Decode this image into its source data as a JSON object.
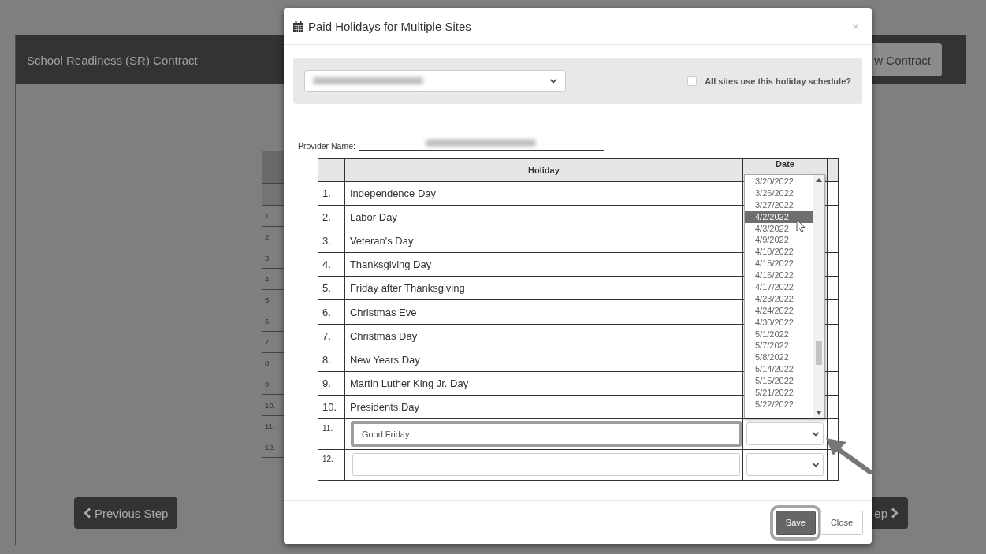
{
  "page": {
    "title": "School Readiness (SR) Contract",
    "header_button": "w Contract",
    "background_rows": [
      "1.",
      "2.",
      "3.",
      "4.",
      "5.",
      "6.",
      "7.",
      "8.",
      "9.",
      "10.",
      "11.",
      "12."
    ],
    "previous_button": "Previous Step",
    "next_button": "ep"
  },
  "modal": {
    "title": "Paid Holidays for Multiple Sites",
    "close": "×",
    "all_sites": {
      "label": "All sites use this holiday schedule?",
      "checked": false
    },
    "provider_label": "Provider Name:",
    "columns": [
      "Holiday",
      "Date"
    ],
    "rows": [
      {
        "number": "1.",
        "kind": "text",
        "holiday": "Independence Day"
      },
      {
        "number": "2.",
        "kind": "text",
        "holiday": "Labor Day"
      },
      {
        "number": "3.",
        "kind": "text",
        "holiday": "Veteran's Day"
      },
      {
        "number": "4.",
        "kind": "text",
        "holiday": "Thanksgiving Day"
      },
      {
        "number": "5.",
        "kind": "text",
        "holiday": "Friday after Thanksgiving"
      },
      {
        "number": "6.",
        "kind": "text",
        "holiday": "Christmas Eve"
      },
      {
        "number": "7.",
        "kind": "text",
        "holiday": "Christmas Day"
      },
      {
        "number": "8.",
        "kind": "text",
        "holiday": "New Years Day"
      },
      {
        "number": "9.",
        "kind": "text",
        "holiday": "Martin Luther King Jr. Day"
      },
      {
        "number": "10.",
        "kind": "text",
        "holiday": "Presidents Day"
      },
      {
        "number": "11.",
        "kind": "input",
        "holiday": "Good Friday",
        "highlighted": true
      },
      {
        "number": "12.",
        "kind": "input",
        "highlighted": false
      }
    ],
    "date_options": [
      {
        "label": "3/20/2022",
        "selected": false
      },
      {
        "label": "3/26/2022",
        "selected": false
      },
      {
        "label": "3/27/2022",
        "selected": false
      },
      {
        "label": "4/2/2022",
        "selected": true
      },
      {
        "label": "4/3/2022",
        "selected": false
      },
      {
        "label": "4/9/2022",
        "selected": false
      },
      {
        "label": "4/10/2022",
        "selected": false
      },
      {
        "label": "4/15/2022",
        "selected": false
      },
      {
        "label": "4/16/2022",
        "selected": false
      },
      {
        "label": "4/17/2022",
        "selected": false
      },
      {
        "label": "4/23/2022",
        "selected": false
      },
      {
        "label": "4/24/2022",
        "selected": false
      },
      {
        "label": "4/30/2022",
        "selected": false
      },
      {
        "label": "5/1/2022",
        "selected": false
      },
      {
        "label": "5/7/2022",
        "selected": false
      },
      {
        "label": "5/8/2022",
        "selected": false
      },
      {
        "label": "5/14/2022",
        "selected": false
      },
      {
        "label": "5/15/2022",
        "selected": false
      },
      {
        "label": "5/21/2022",
        "selected": false
      },
      {
        "label": "5/22/2022",
        "selected": false
      }
    ],
    "buttons": [
      {
        "label": "Save",
        "kind": "primary",
        "highlighted": true
      },
      {
        "label": "Close",
        "kind": "default",
        "highlighted": false
      }
    ]
  }
}
